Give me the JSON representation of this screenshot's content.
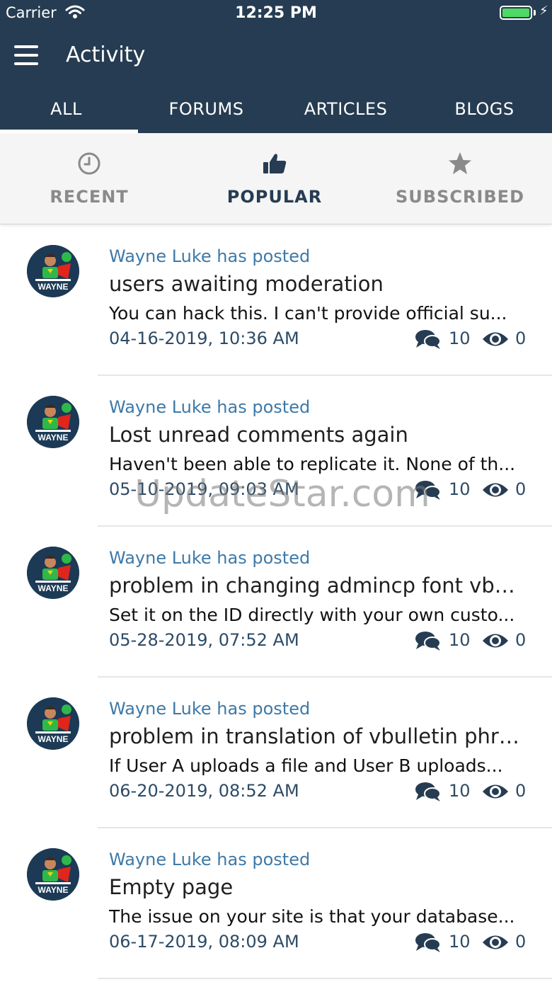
{
  "status_bar": {
    "carrier": "Carrier",
    "time": "12:25 PM"
  },
  "header": {
    "title": "Activity"
  },
  "tabs": [
    {
      "label": "ALL",
      "active": true
    },
    {
      "label": "FORUMS",
      "active": false
    },
    {
      "label": "ARTICLES",
      "active": false
    },
    {
      "label": "BLOGS",
      "active": false
    }
  ],
  "filters": [
    {
      "label": "RECENT",
      "icon": "clock-icon",
      "active": false
    },
    {
      "label": "POPULAR",
      "icon": "thumbs-up-icon",
      "active": true
    },
    {
      "label": "SUBSCRIBED",
      "icon": "star-icon",
      "active": false
    }
  ],
  "posts": [
    {
      "poster": "Wayne Luke has posted",
      "title": "users awaiting moderation",
      "snippet": "You can hack this. I can't provide official su...",
      "date": "04-16-2019, 10:36 AM",
      "comments": "10",
      "views": "0"
    },
    {
      "poster": "Wayne Luke has posted",
      "title": "Lost unread comments again",
      "snippet": "Haven't been able to replicate it. None of th...",
      "date": "05-10-2019, 09:03 AM",
      "comments": "10",
      "views": "0"
    },
    {
      "poster": "Wayne Luke has posted",
      "title": "problem in changing admincp font vbu...",
      "snippet": "Set it on the ID directly with your own custo...",
      "date": "05-28-2019, 07:52 AM",
      "comments": "10",
      "views": "0"
    },
    {
      "poster": "Wayne Luke has posted",
      "title": "problem in translation of vbulletin phra...",
      "snippet": "If User A uploads a file and User B uploads...",
      "date": "06-20-2019, 08:52 AM",
      "comments": "10",
      "views": "0"
    },
    {
      "poster": "Wayne Luke has posted",
      "title": "Empty page",
      "snippet": "The issue on your site is that your database...",
      "date": "06-17-2019, 08:09 AM",
      "comments": "10",
      "views": "0"
    }
  ],
  "avatar_text": "WAYNE",
  "watermark": "UpdateStar.com",
  "colors": {
    "header_bg": "#263c52",
    "link": "#3d79a8",
    "battery": "#4cd964"
  }
}
